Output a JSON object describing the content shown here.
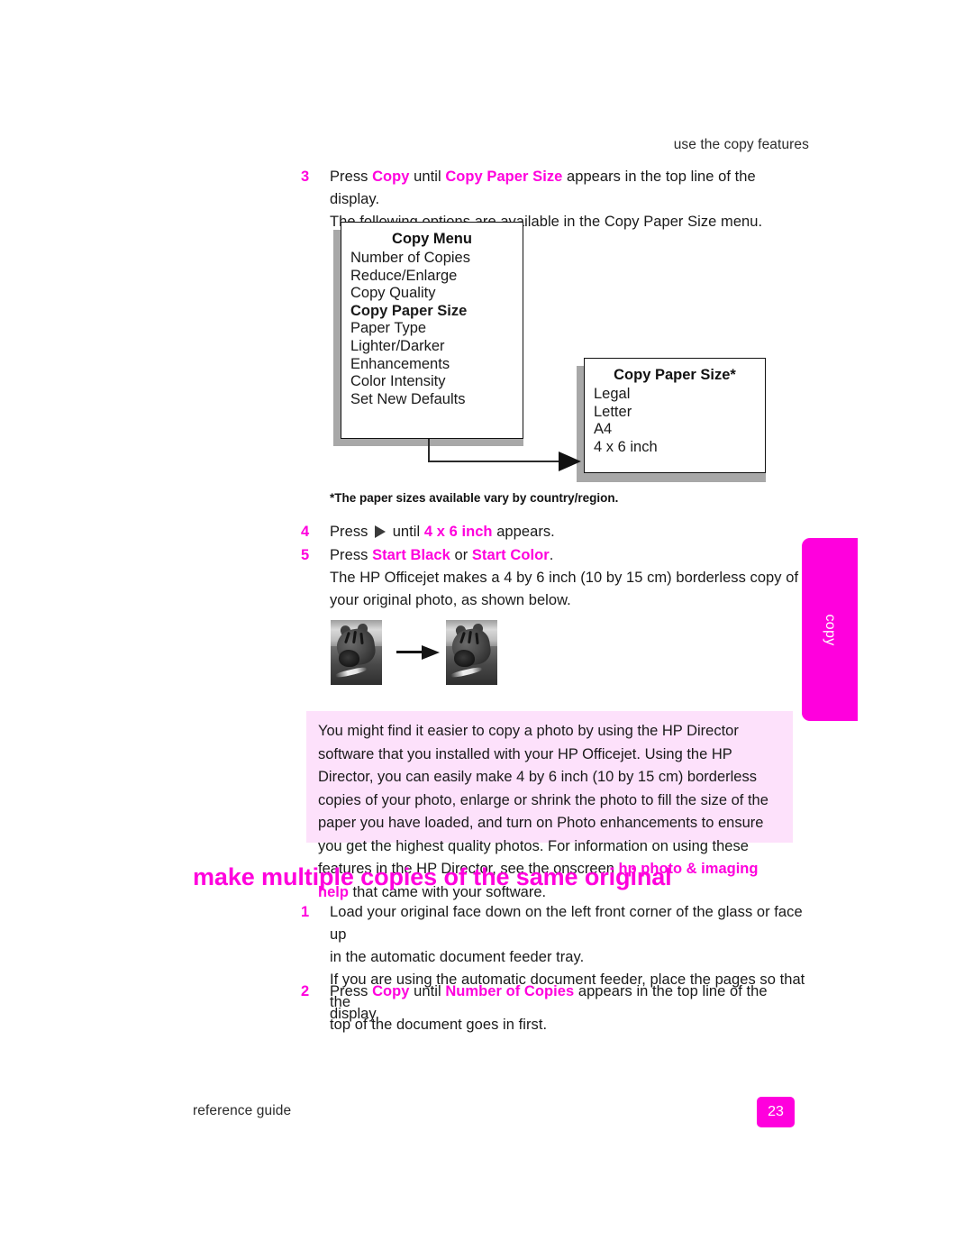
{
  "header": {
    "running_head": "use the copy features"
  },
  "colors": {
    "magenta": "#ff00dd",
    "note_bg": "#fde1fb",
    "shadow": "#a8a8a8"
  },
  "steps_top": [
    {
      "num": "3",
      "line1_a": "Press ",
      "line1_b": "Copy",
      "line1_c": " until ",
      "line1_d": "Copy Paper Size",
      "line1_e": " appears in the top line of the display.",
      "line2": "The following options are available in the Copy Paper Size menu."
    }
  ],
  "copy_menu_box": {
    "title": "Copy Menu",
    "items": [
      {
        "label": "Number of Copies",
        "bold": false
      },
      {
        "label": "Reduce/Enlarge",
        "bold": false
      },
      {
        "label": "Copy Quality",
        "bold": false
      },
      {
        "label": "Copy Paper Size",
        "bold": true
      },
      {
        "label": "Paper Type",
        "bold": false
      },
      {
        "label": "Lighter/Darker",
        "bold": false
      },
      {
        "label": "Enhancements",
        "bold": false
      },
      {
        "label": "Color Intensity",
        "bold": false
      },
      {
        "label": "Set New Defaults",
        "bold": false
      }
    ]
  },
  "paper_size_box": {
    "title": "Copy Paper Size*",
    "items": [
      {
        "label": "Legal"
      },
      {
        "label": "Letter"
      },
      {
        "label": "A4"
      },
      {
        "label": "4 x 6 inch"
      }
    ]
  },
  "footnote": "*The paper sizes available vary by country/region.",
  "steps_mid": {
    "step4": {
      "num": "4",
      "a": "Press ",
      "arrow_icon": "right-arrow-icon",
      "b": " until ",
      "c": "4 x 6 inch",
      "d": " appears."
    },
    "step5": {
      "num": "5",
      "a": "Press ",
      "b": "Start Black",
      "c": " or ",
      "d": "Start Color",
      "e": ".",
      "line2": "The HP Officejet makes a 4 by 6 inch (10 by 15 cm) borderless copy of",
      "line3": "your original photo, as shown below."
    }
  },
  "note": {
    "body_a": "You might find it easier to copy a photo by using the HP Director software that you installed with your HP Officejet. Using the HP Director, you can easily make 4 by 6 inch (10 by 15 cm) borderless copies of your photo, enlarge or shrink the photo to fill the size of the paper you have loaded, and turn on Photo enhancements to ensure you get the highest quality photos. For information on using these features in the HP Director, see the onscreen ",
    "body_link": "hp photo & imaging help",
    "body_b": " that came with your software."
  },
  "section_heading": "make multiple copies of the same original",
  "steps_bottom": {
    "step1": {
      "num": "1",
      "line1": "Load your original face down on the left front corner of the glass or face up",
      "line2": "in the automatic document feeder tray.",
      "line3": "If you are using the automatic document feeder, place the pages so that the",
      "line4": "top of the document goes in first."
    },
    "step2": {
      "num": "2",
      "a": "Press ",
      "b": "Copy",
      "c": " until ",
      "d": "Number of Copies",
      "e": " appears in the top line of the display."
    }
  },
  "side_tab": {
    "label": "copy"
  },
  "footer": {
    "left": "reference guide",
    "page_number": "23"
  }
}
